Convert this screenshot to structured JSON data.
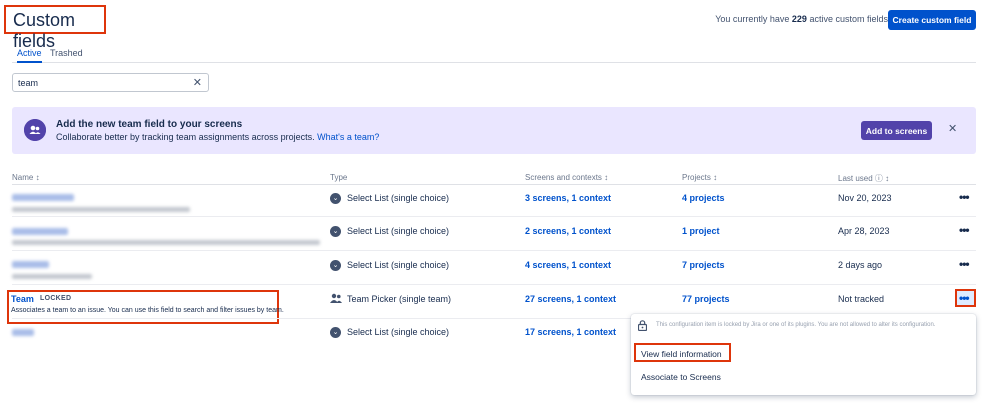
{
  "header": {
    "title": "Custom fields",
    "info_prefix": "You currently have",
    "info_count": "229",
    "info_suffix": "active custom fields",
    "create_button": "Create custom field"
  },
  "tabs": [
    {
      "label": "Active",
      "active": true
    },
    {
      "label": "Trashed",
      "active": false
    }
  ],
  "search": {
    "value": "team",
    "clear_icon": "close-icon"
  },
  "banner": {
    "icon": "team-icon",
    "title": "Add the new team field to your screens",
    "text": "Collaborate better by tracking team assignments across projects.",
    "link": "What's a team?",
    "button": "Add to screens",
    "close_icon": "close-icon"
  },
  "table": {
    "columns": [
      "Name ↕",
      "Type",
      "Screens and contexts ↕",
      "Projects ↕",
      "Last used ⓘ ↕"
    ],
    "rows": [
      {
        "type": "Select List (single choice)",
        "screens": "3 screens, 1 context",
        "projects": "4 projects",
        "last_used": "Nov 20, 2023"
      },
      {
        "type": "Select List (single choice)",
        "screens": "2 screens, 1 context",
        "projects": "1 project",
        "last_used": "Apr 28, 2023"
      },
      {
        "type": "Select List (single choice)",
        "screens": "4 screens, 1 context",
        "projects": "7 projects",
        "last_used": "2 days ago"
      },
      {
        "name": "Team",
        "badge": "LOCKED",
        "description": "Associates a team to an issue. You can use this field to search and filter issues by team.",
        "type": "Team Picker (single team)",
        "screens": "27 screens, 1 context",
        "projects": "77 projects",
        "last_used": "Not tracked"
      },
      {
        "type": "Select List (single choice)",
        "screens": "17 screens, 1 context"
      }
    ]
  },
  "dropdown": {
    "note": "This configuration item is locked by Jira or one of its plugins. You are not allowed to alter its configuration.",
    "items": [
      "View field information",
      "Associate to Screens"
    ]
  },
  "colors": {
    "primary": "#0052cc",
    "purple": "#5243aa",
    "banner_bg": "#eae6ff",
    "highlight": "#de350b"
  }
}
